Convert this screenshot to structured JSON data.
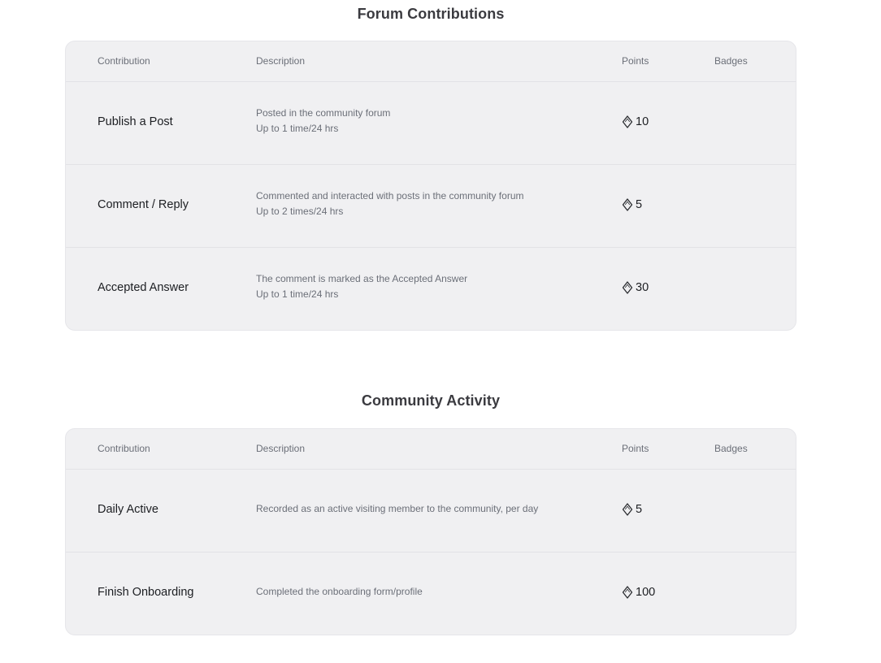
{
  "sections": [
    {
      "title": "Forum Contributions",
      "headers": {
        "contribution": "Contribution",
        "description": "Description",
        "points": "Points",
        "badges": "Badges"
      },
      "rows": [
        {
          "contribution": "Publish a Post",
          "description_line1": "Posted in the community forum",
          "description_line2": "Up to 1 time/24 hrs",
          "points": "10",
          "points_icon": "diamond-icon"
        },
        {
          "contribution": "Comment / Reply",
          "description_line1": "Commented and interacted with posts in the community forum",
          "description_line2": "Up to 2 times/24 hrs",
          "points": "5",
          "points_icon": "diamond-icon"
        },
        {
          "contribution": "Accepted Answer",
          "description_line1": "The comment is marked as the Accepted Answer",
          "description_line2": "Up to 1 time/24 hrs",
          "points": "30",
          "points_icon": "diamond-icon"
        }
      ]
    },
    {
      "title": "Community Activity",
      "headers": {
        "contribution": "Contribution",
        "description": "Description",
        "points": "Points",
        "badges": "Badges"
      },
      "rows": [
        {
          "contribution": "Daily Active",
          "description_line1": "Recorded as an active visiting member to the community, per day",
          "points": "5",
          "points_icon": "diamond-icon"
        },
        {
          "contribution": "Finish Onboarding",
          "description_line1": "Completed the onboarding form/profile",
          "points": "100",
          "points_icon": "diamond-icon"
        }
      ]
    }
  ],
  "colors": {
    "card_background": "#f0f0f2",
    "header_text": "#6b6f78",
    "body_text": "#1c1e22",
    "title_text": "#3b3b40"
  }
}
